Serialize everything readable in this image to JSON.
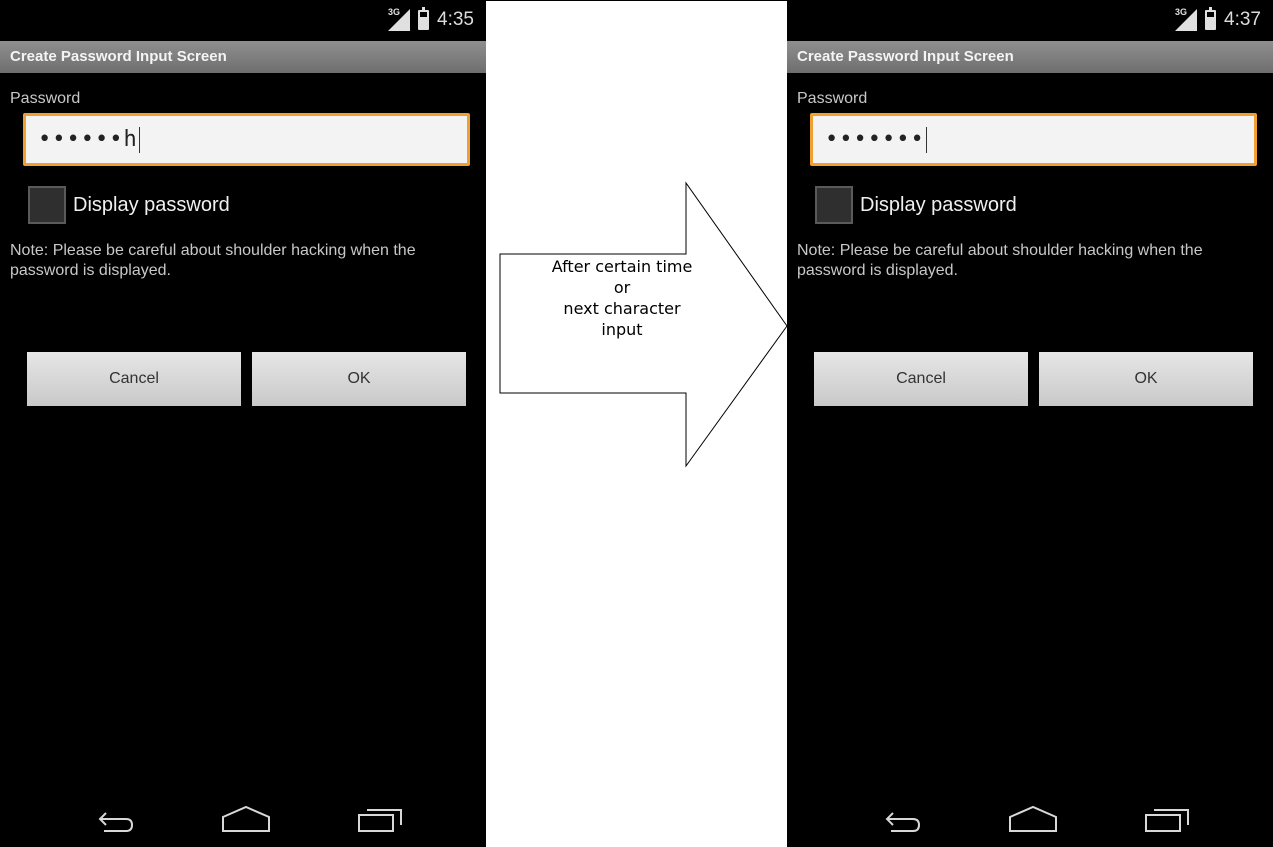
{
  "left_phone": {
    "status_time": "4:35",
    "network_type": "3G",
    "title": "Create Password Input Screen",
    "password_label": "Password",
    "password_value": "••••••h",
    "checkbox_label": "Display password",
    "checkbox_checked": false,
    "note": "Note: Please be careful about shoulder hacking when the password is displayed.",
    "cancel_label": "Cancel",
    "ok_label": "OK",
    "nav_icons": [
      "back-icon",
      "home-icon",
      "recent-apps-icon"
    ]
  },
  "transition": {
    "line1": "After certain time",
    "line2": "or",
    "line3": "next character",
    "line4": "input"
  },
  "right_phone": {
    "status_time": "4:37",
    "network_type": "3G",
    "title": "Create Password Input Screen",
    "password_label": "Password",
    "password_value": "•••••••",
    "checkbox_label": "Display password",
    "checkbox_checked": false,
    "note": "Note: Please be careful about shoulder hacking when the password is displayed.",
    "cancel_label": "Cancel",
    "ok_label": "OK",
    "nav_icons": [
      "back-icon",
      "home-icon",
      "recent-apps-icon"
    ]
  },
  "colors": {
    "field_focus_border": "#f0a030",
    "title_bar": "#7f7f7f",
    "screen_background": "#000000"
  }
}
